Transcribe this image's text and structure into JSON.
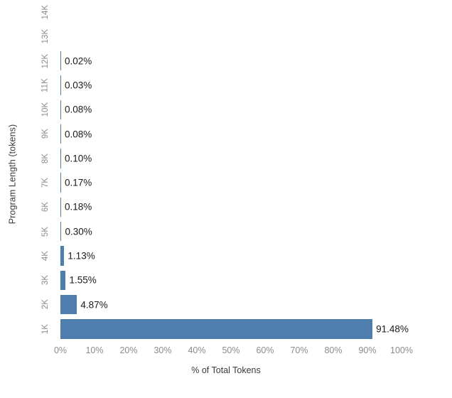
{
  "chart_data": {
    "type": "bar",
    "orientation": "horizontal",
    "title": "",
    "xlabel": "% of Total Tokens",
    "ylabel": "Program Length (tokens)",
    "categories": [
      "1K",
      "2K",
      "3K",
      "4K",
      "5K",
      "6K",
      "7K",
      "8K",
      "9K",
      "10K",
      "11K",
      "12K",
      "13K",
      "14K"
    ],
    "values": [
      91.48,
      4.87,
      1.55,
      1.13,
      0.3,
      0.18,
      0.17,
      0.1,
      0.08,
      0.08,
      0.03,
      0.02,
      null,
      null
    ],
    "data_labels": [
      "91.48%",
      "4.87%",
      "1.55%",
      "1.13%",
      "0.30%",
      "0.18%",
      "0.17%",
      "0.10%",
      "0.08%",
      "0.08%",
      "0.03%",
      "0.02%",
      "",
      ""
    ],
    "xtick_labels": [
      "0%",
      "10%",
      "20%",
      "30%",
      "40%",
      "50%",
      "60%",
      "70%",
      "80%",
      "90%",
      "100%"
    ],
    "xtick_values": [
      0,
      10,
      20,
      30,
      40,
      50,
      60,
      70,
      80,
      90,
      100
    ],
    "xlim": [
      0,
      100
    ],
    "grid": false,
    "legend": false,
    "bar_color": "#4e7ead",
    "label_color": "#1a1a1a",
    "tick_color": "#8c8c8c",
    "axis_title_color": "#3a3a3a",
    "background": "#ffffff"
  },
  "clipped_caption": ""
}
